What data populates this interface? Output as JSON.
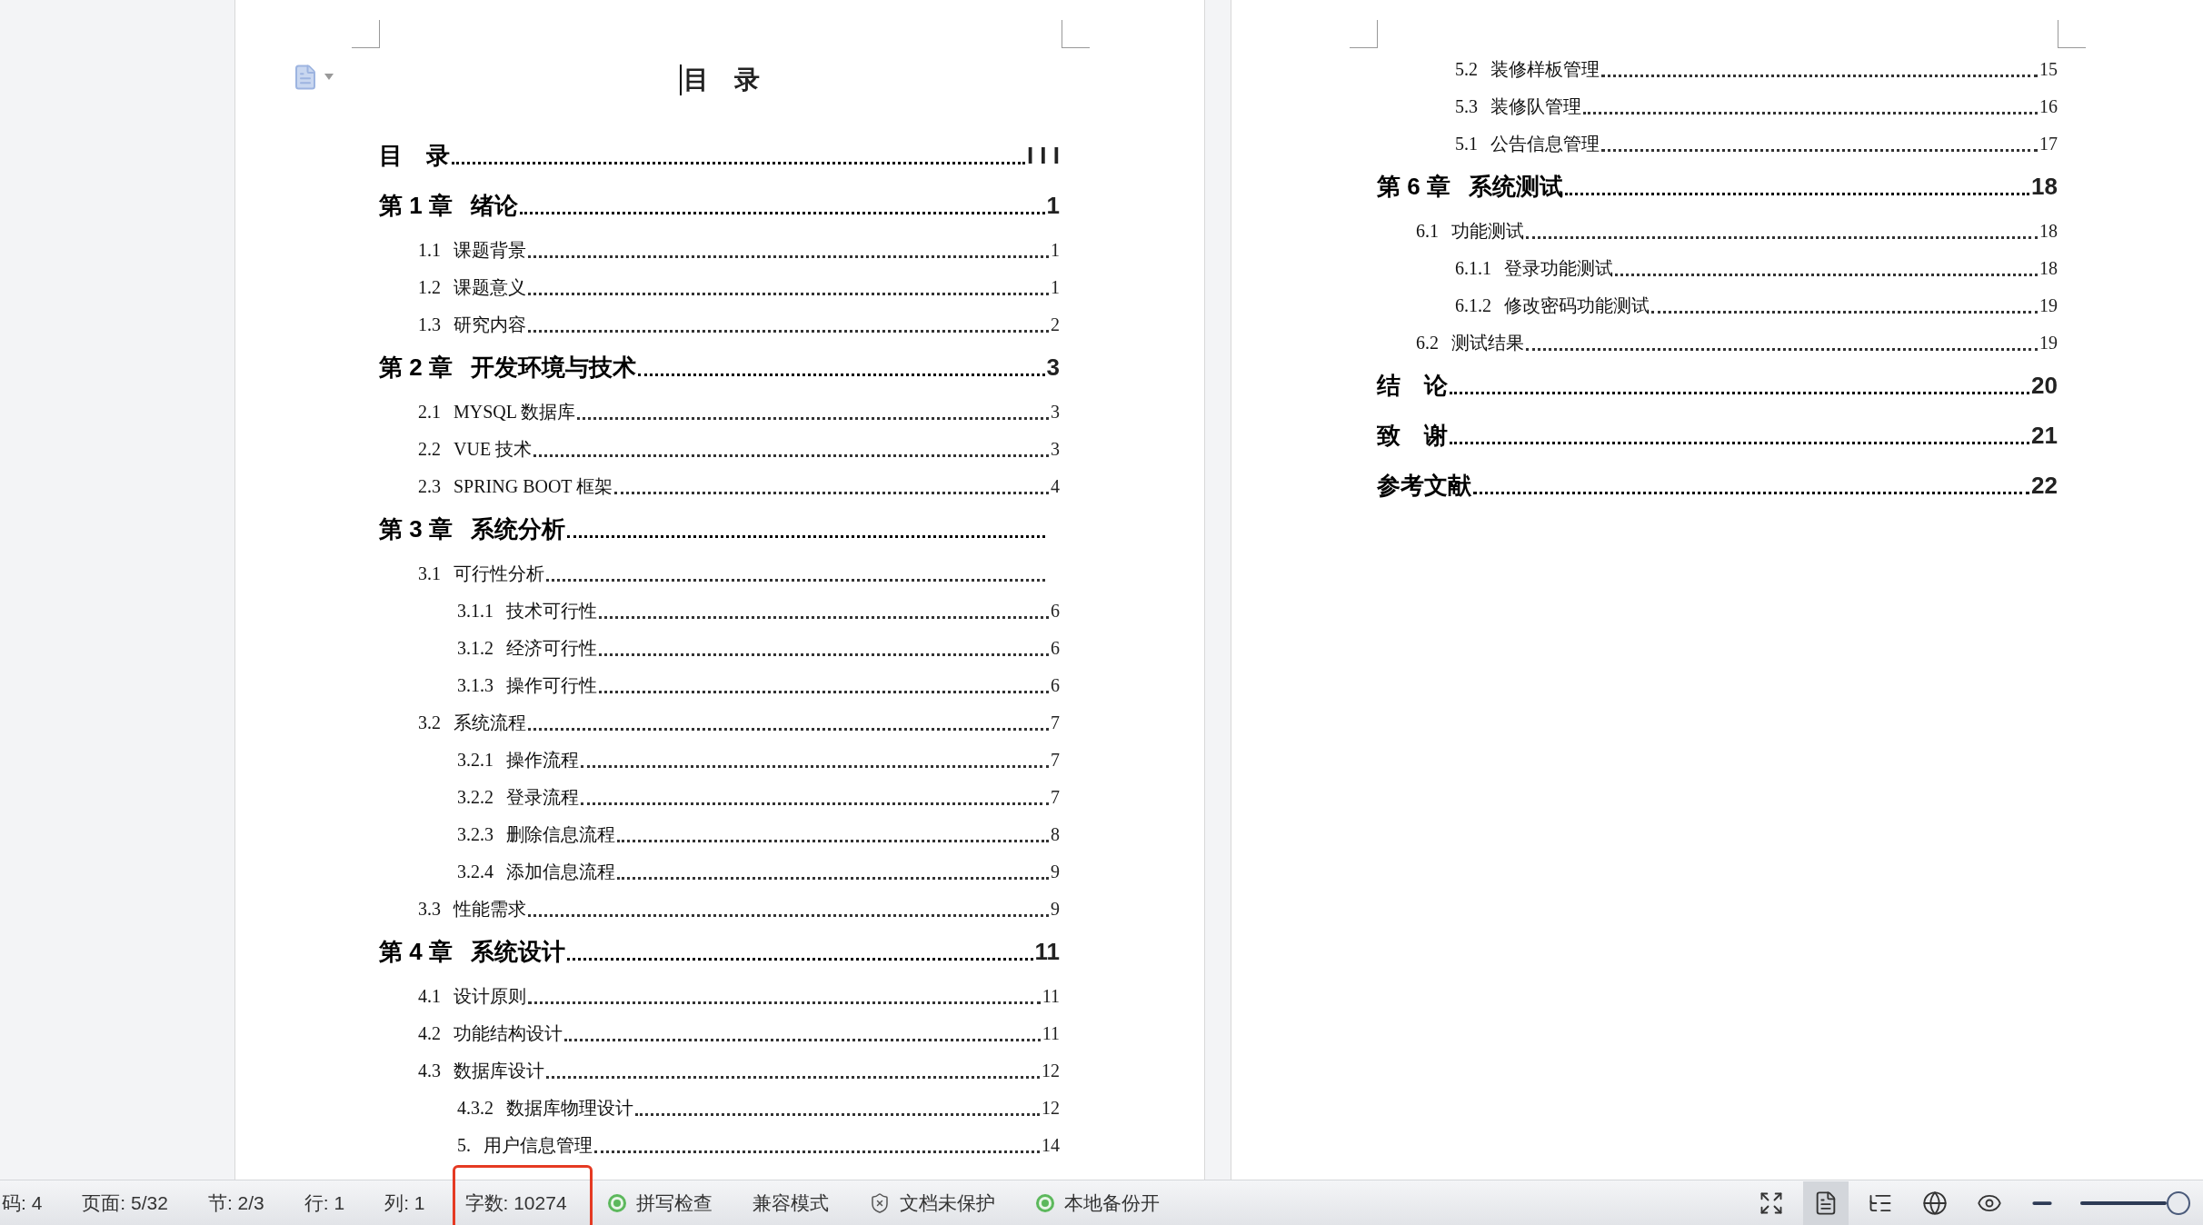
{
  "left_page": {
    "heading": "目　录",
    "entries": [
      {
        "title": "目　录",
        "page": "I I I"
      },
      {
        "number": "第 1 章",
        "title": "绪论",
        "page": "1",
        "children": [
          {
            "number": "1.1",
            "title": "课题背景",
            "page": "1"
          },
          {
            "number": "1.2",
            "title": "课题意义",
            "page": "1"
          },
          {
            "number": "1.3",
            "title": "研究内容",
            "page": "2"
          }
        ]
      },
      {
        "number": "第 2 章",
        "title": "开发环境与技术",
        "page": "3",
        "children": [
          {
            "number": "2.1",
            "title": "MYSQL 数据库",
            "page": "3"
          },
          {
            "number": "2.2",
            "title": "VUE 技术",
            "page": "3"
          },
          {
            "number": "2.3",
            "title": "SPRING BOOT 框架",
            "page": "4"
          }
        ]
      },
      {
        "number": "第 3 章",
        "title": "系统分析",
        "children": [
          {
            "number": "3.1",
            "title": "可行性分析",
            "children": [
              {
                "number": "3.1.1",
                "title": "技术可行性",
                "page": "6"
              },
              {
                "number": "3.1.2",
                "title": "经济可行性",
                "page": "6"
              },
              {
                "number": "3.1.3",
                "title": "操作可行性",
                "page": "6"
              }
            ]
          },
          {
            "number": "3.2",
            "title": "系统流程",
            "page": "7",
            "children": [
              {
                "number": "3.2.1",
                "title": "操作流程",
                "page": "7"
              },
              {
                "number": "3.2.2",
                "title": "登录流程",
                "page": "7"
              },
              {
                "number": "3.2.3",
                "title": "删除信息流程",
                "page": "8"
              },
              {
                "number": "3.2.4",
                "title": "添加信息流程",
                "page": "9"
              }
            ]
          },
          {
            "number": "3.3",
            "title": "性能需求",
            "page": "9"
          }
        ]
      },
      {
        "number": "第 4 章",
        "title": "系统设计",
        "page": "11",
        "children": [
          {
            "number": "4.1",
            "title": "设计原则",
            "page": "11"
          },
          {
            "number": "4.2",
            "title": "功能结构设计",
            "page": "11"
          },
          {
            "number": "4.3",
            "title": "数据库设计",
            "page": "12",
            "children": [
              {
                "number": "4.3.2",
                "title": "数据库物理设计",
                "page": "12"
              },
              {
                "number": "5.",
                "title": "用户信息管理",
                "page": "14"
              }
            ]
          }
        ]
      }
    ]
  },
  "right_page": {
    "entries": [
      {
        "children": [
          {
            "children": [
              {
                "number": "5.2",
                "title": "装修样板管理",
                "page": "15"
              },
              {
                "number": "5.3",
                "title": "装修队管理",
                "page": "16"
              },
              {
                "number": "5.1",
                "title": "公告信息管理",
                "page": "17"
              }
            ]
          }
        ]
      },
      {
        "number": "第 6 章",
        "title": "系统测试",
        "page": "18",
        "children": [
          {
            "number": "6.1",
            "title": "功能测试",
            "page": "18",
            "children": [
              {
                "number": "6.1.1",
                "title": "登录功能测试",
                "page": "18"
              },
              {
                "number": "6.1.2",
                "title": "修改密码功能测试",
                "page": "19"
              }
            ]
          },
          {
            "number": "6.2",
            "title": "测试结果",
            "page": "19"
          }
        ]
      },
      {
        "title": "结　论",
        "page": "20"
      },
      {
        "title": "致　谢",
        "page": "21"
      },
      {
        "title": "参考文献",
        "page": "22"
      }
    ]
  },
  "status_bar": {
    "items": [
      {
        "kind": "text",
        "label": "码: 4",
        "highlighted": false
      },
      {
        "kind": "text",
        "label": "页面: 5/32",
        "highlighted": false
      },
      {
        "kind": "text",
        "label": "节: 2/3",
        "highlighted": false
      },
      {
        "kind": "text",
        "label": "行: 1",
        "highlighted": false
      },
      {
        "kind": "text",
        "label": "列: 1",
        "highlighted": false
      },
      {
        "kind": "text",
        "label": "字数: 10274",
        "highlighted": true
      },
      {
        "kind": "check",
        "label": "拼写检查",
        "highlighted": false
      },
      {
        "kind": "text",
        "label": "兼容模式",
        "highlighted": false
      },
      {
        "kind": "shield",
        "label": "文档未保护",
        "highlighted": false
      },
      {
        "kind": "check",
        "label": "本地备份开",
        "highlighted": false
      }
    ],
    "views": [
      {
        "kind": "fullscreen",
        "selected": false
      },
      {
        "kind": "page",
        "selected": true
      },
      {
        "kind": "outline",
        "selected": false
      },
      {
        "kind": "web",
        "selected": false
      },
      {
        "kind": "eye",
        "selected": false
      }
    ],
    "zoom": {
      "level": 1
    }
  }
}
